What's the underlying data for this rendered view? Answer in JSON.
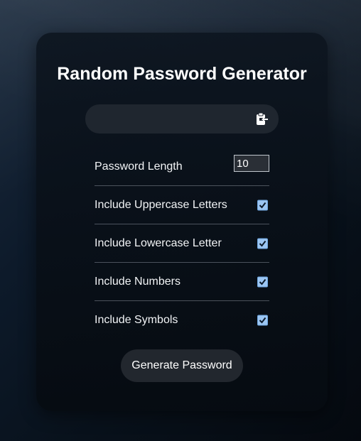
{
  "app": {
    "title": "Random Password Generator"
  },
  "result": {
    "value": "",
    "placeholder": ""
  },
  "settings": {
    "length_label": "Password Length",
    "length_value": "10",
    "options": [
      {
        "label": "Include Uppercase Letters",
        "checked": true
      },
      {
        "label": "Include Lowercase Letter",
        "checked": true
      },
      {
        "label": "Include Numbers",
        "checked": true
      },
      {
        "label": "Include Symbols",
        "checked": true
      }
    ]
  },
  "actions": {
    "generate_label": "Generate Password"
  },
  "icons": {
    "clipboard": "clipboard-icon",
    "check": "check-icon"
  },
  "colors": {
    "checkbox_fill": "#9cc6f3",
    "card_bg": "#0b131c",
    "button_bg": "#22272e"
  }
}
